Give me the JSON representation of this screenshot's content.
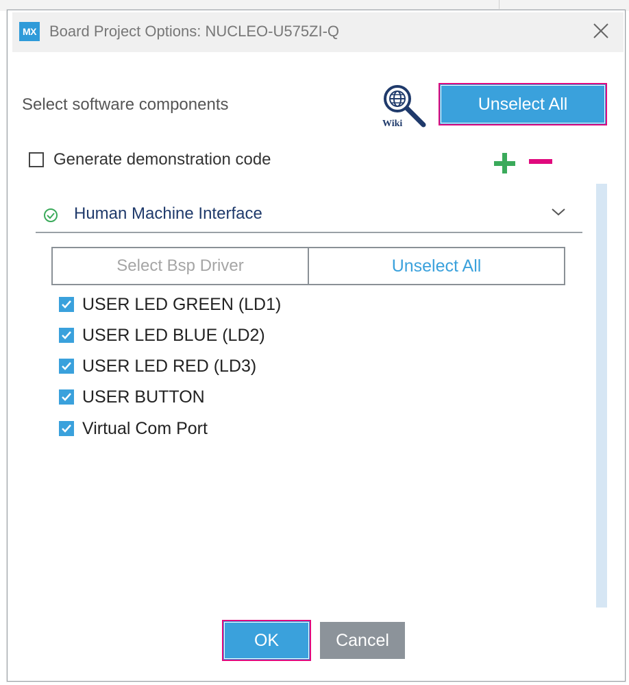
{
  "window": {
    "logo_text": "MX",
    "title": "Board Project Options: NUCLEO-U575ZI-Q",
    "close_icon": "close-icon"
  },
  "header": {
    "select_label": "Select software components",
    "wiki_icon": "wiki-search-icon",
    "wiki_text": "Wiki",
    "unselect_all_label": "Unselect All"
  },
  "demo": {
    "label": "Generate demonstration code",
    "checked": false
  },
  "expand_controls": {
    "plus_icon": "plus-icon",
    "minus_icon": "minus-icon",
    "plus_color": "#3aaa5a",
    "minus_color": "#e0097d"
  },
  "accordion": {
    "title": "Human Machine Interface",
    "status_icon": "check-circle-icon",
    "expand_icon": "chevron-down-icon",
    "select_bsp_label": "Select Bsp Driver",
    "unselect_all_label": "Unselect All",
    "items": [
      {
        "label": "USER LED GREEN (LD1)",
        "checked": true
      },
      {
        "label": "USER LED BLUE (LD2)",
        "checked": true
      },
      {
        "label": "USER LED RED (LD3)",
        "checked": true
      },
      {
        "label": "USER BUTTON",
        "checked": true
      },
      {
        "label": "Virtual Com Port",
        "checked": true
      }
    ]
  },
  "footer": {
    "ok_label": "OK",
    "cancel_label": "Cancel"
  },
  "colors": {
    "accent": "#3aa1dc",
    "highlight_border": "#e0097d",
    "cancel_bg": "#8c939a"
  }
}
